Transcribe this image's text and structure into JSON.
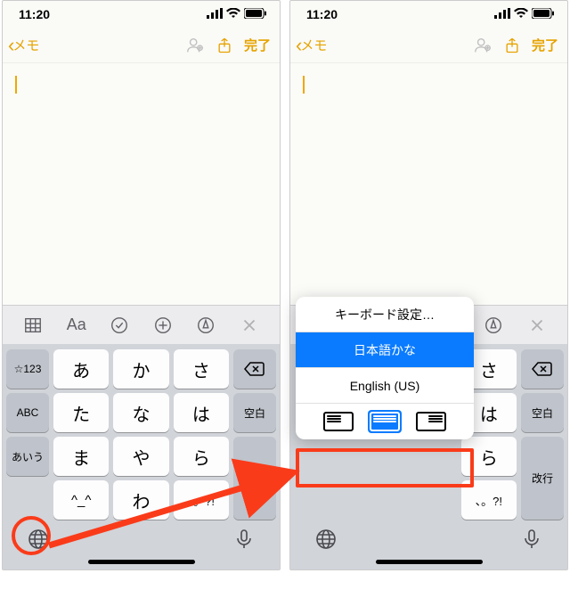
{
  "status": {
    "time": "11:20"
  },
  "nav": {
    "back_label": "メモ",
    "done_label": "完了"
  },
  "toolbar": {
    "grid": "grid",
    "aa": "Aa",
    "check": "check",
    "plus": "plus",
    "pen": "pen",
    "close": "close"
  },
  "keyboard": {
    "rows": [
      {
        "side_l": "☆123",
        "c1": "あ",
        "c2": "か",
        "c3": "さ",
        "side_r": "del"
      },
      {
        "side_l": "ABC",
        "c1": "た",
        "c2": "な",
        "c3": "は",
        "side_r": "空白"
      },
      {
        "side_l": "あいう",
        "c1": "ま",
        "c2": "や",
        "c3": "ら",
        "side_r": "改行"
      },
      {
        "side_l": "",
        "c1": "^_^",
        "c2": "わ",
        "c3": "、。?!",
        "side_r": ""
      }
    ]
  },
  "popup": {
    "settings": "キーボード設定…",
    "jp": "日本語かな",
    "en": "English (US)"
  }
}
